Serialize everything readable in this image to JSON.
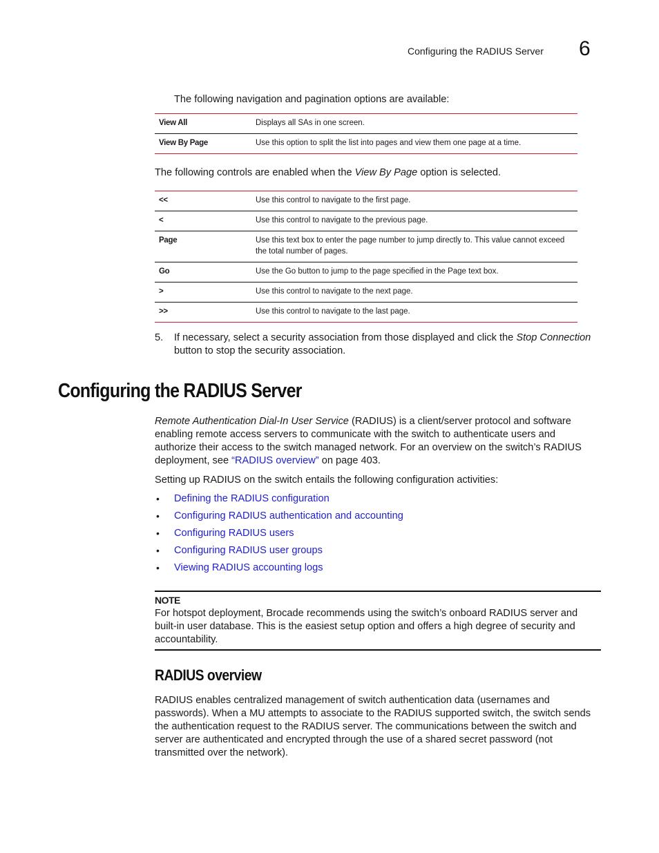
{
  "header": {
    "running_title": "Configuring the RADIUS Server",
    "chapter_number": "6"
  },
  "nav_intro": "The following navigation and pagination options are available:",
  "nav_table": [
    {
      "key": "View All",
      "desc": "Displays all SAs in one screen."
    },
    {
      "key": "View By Page",
      "desc": "Use this option to split the list into pages and view them one page at a time."
    }
  ],
  "controls_intro": {
    "before": "The following controls are enabled when the ",
    "emphasis": "View By Page",
    "after": " option is selected."
  },
  "controls_table": [
    {
      "key": "<<",
      "desc": "Use this control to navigate to the first page."
    },
    {
      "key": "<",
      "desc": "Use this control to navigate to the previous page."
    },
    {
      "key": "Page",
      "desc": "Use this text box to enter the page number to jump directly to. This value cannot exceed the total number of pages."
    },
    {
      "key": "Go",
      "desc": "Use the Go button to jump to the page specified in the Page text box."
    },
    {
      "key": ">",
      "desc": "Use this control to navigate to the next page."
    },
    {
      "key": ">>",
      "desc": "Use this control to navigate to the last page."
    }
  ],
  "step5": {
    "number": "5.",
    "before": "If necessary, select a security association from those displayed and click the ",
    "emphasis": "Stop Connection",
    "after": " button to stop the security association."
  },
  "section": {
    "title": "Configuring the RADIUS Server",
    "para1": {
      "emphasis": "Remote Authentication Dial-In User Service",
      "text": " (RADIUS) is a client/server protocol and software enabling remote access servers to communicate with the switch to authenticate users and authorize their access to the switch managed network. For an overview on the switch’s RADIUS deployment, see ",
      "link": "“RADIUS overview”",
      "after": " on page 403."
    },
    "para2": "Setting up RADIUS on the switch entails the following configuration activities:",
    "bullet_glyph": "•",
    "links": [
      "Defining the RADIUS configuration",
      "Configuring RADIUS authentication and accounting",
      "Configuring RADIUS users",
      "Configuring RADIUS user groups",
      "Viewing RADIUS accounting logs"
    ],
    "note": {
      "label": "NOTE",
      "text": "For hotspot deployment, Brocade recommends using the switch’s onboard RADIUS server and built-in user database. This is the easiest setup option and offers a high degree of security and accountability."
    }
  },
  "subsection": {
    "title": "RADIUS overview",
    "para": "RADIUS enables centralized management of switch authentication data (usernames and passwords). When a MU attempts to associate to the RADIUS supported switch, the switch sends the authentication request to the RADIUS server. The communications between the switch and server are authenticated and encrypted through the use of a shared secret password (not transmitted over the network)."
  },
  "colors": {
    "table_rule": "#d7152b",
    "link": "#2020d0",
    "text": "#1a1a1a"
  }
}
